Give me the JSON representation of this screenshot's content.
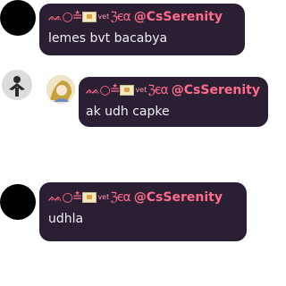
{
  "messages": [
    {
      "author": {
        "deco_prefix": "ᨐ○≛",
        "vet": "vet",
        "deco_suffix": "ℨєα",
        "handle": "@CsSerenity"
      },
      "text": "lemes bvt bacabya"
    },
    {
      "author": {
        "deco_prefix": "ᨐ○≛",
        "vet": "vet",
        "deco_suffix": "ℨєα",
        "handle": "@CsSerenity"
      },
      "text": "ak udh capke"
    },
    {
      "author": {
        "deco_prefix": "ᨐ○≛",
        "vet": "vet",
        "deco_suffix": "ℨєα",
        "handle": "@CsSerenity"
      },
      "text": "udhla"
    }
  ]
}
